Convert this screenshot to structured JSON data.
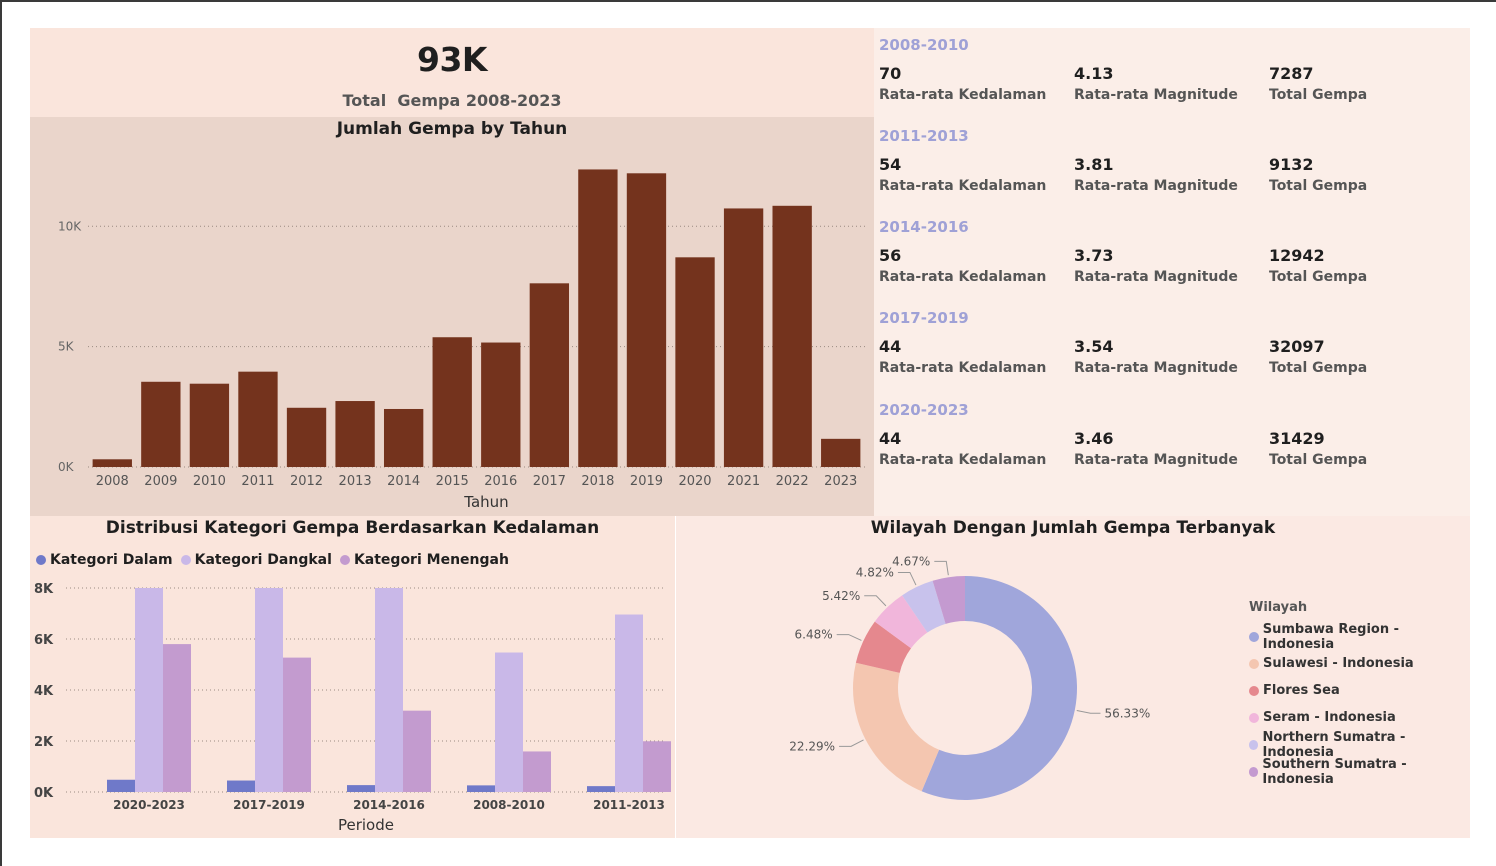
{
  "kpi": {
    "value": "93K",
    "label": "Total  Gempa 2008-2023"
  },
  "colors": {
    "bar_year": "#74331d",
    "dalam": "#6f79c9",
    "dangkal": "#c9b8e8",
    "menengah": "#c39bcf",
    "period_title": "#9fa1d6"
  },
  "periods": [
    {
      "title": "2008-2010",
      "depth": "70",
      "magnitude": "4.13",
      "total": "7287"
    },
    {
      "title": "2011-2013",
      "depth": "54",
      "magnitude": "3.81",
      "total": "9132"
    },
    {
      "title": "2014-2016",
      "depth": "56",
      "magnitude": "3.73",
      "total": "12942"
    },
    {
      "title": "2017-2019",
      "depth": "44",
      "magnitude": "3.54",
      "total": "32097"
    },
    {
      "title": "2020-2023",
      "depth": "44",
      "magnitude": "3.46",
      "total": "31429"
    }
  ],
  "stat_labels": {
    "depth": "Rata-rata Kedalaman",
    "magnitude": "Rata-rata Magnitude",
    "total": "Total Gempa"
  },
  "chart_data": [
    {
      "type": "bar",
      "title": "Jumlah Gempa by Tahun",
      "xlabel": "Tahun",
      "ylabel": "",
      "categories": [
        "2008",
        "2009",
        "2010",
        "2011",
        "2012",
        "2013",
        "2014",
        "2015",
        "2016",
        "2017",
        "2018",
        "2019",
        "2020",
        "2021",
        "2022",
        "2023"
      ],
      "values": [
        320,
        3540,
        3460,
        3960,
        2460,
        2740,
        2410,
        5390,
        5170,
        7630,
        12360,
        12200,
        8710,
        10740,
        10850,
        1170
      ],
      "ylim": [
        0,
        13500
      ],
      "yticks": [
        0,
        5000,
        10000
      ],
      "ytick_labels": [
        "0K",
        "5K",
        "10K"
      ],
      "grid": true
    },
    {
      "type": "bar",
      "title": "Distribusi Kategori Gempa Berdasarkan Kedalaman",
      "xlabel": "Periode",
      "ylabel": "",
      "categories": [
        "2020-2023",
        "2017-2019",
        "2014-2016",
        "2008-2010",
        "2011-2013"
      ],
      "series": [
        {
          "name": "Kategori Dalam",
          "values": [
            480,
            450,
            270,
            260,
            230
          ]
        },
        {
          "name": "Kategori Dangkal",
          "values": [
            8000,
            8000,
            8000,
            5470,
            6960
          ]
        },
        {
          "name": "Kategori Menengah",
          "values": [
            5800,
            5270,
            3190,
            1590,
            1990
          ]
        }
      ],
      "ylim": [
        0,
        8000
      ],
      "yticks": [
        0,
        2000,
        4000,
        6000,
        8000
      ],
      "ytick_labels": [
        "0K",
        "2K",
        "4K",
        "6K",
        "8K"
      ],
      "legend": "top-left",
      "grid": true
    },
    {
      "type": "pie",
      "title": "Wilayah Dengan Jumlah Gempa Terbanyak",
      "legend_title": "Wilayah",
      "legend": "right",
      "labels": [
        "Sumbawa Region - Indonesia",
        "Sulawesi - Indonesia",
        "Flores Sea",
        "Seram - Indonesia",
        "Northern Sumatra - Indonesia",
        "Southern Sumatra - Indonesia"
      ],
      "values": [
        56.33,
        22.29,
        6.48,
        5.42,
        4.82,
        4.67
      ],
      "value_labels": [
        "56.33%",
        "22.29%",
        "6.48%",
        "5.42%",
        "4.82%",
        "4.67%"
      ],
      "colors": [
        "#a0a6db",
        "#f4c6b0",
        "#e5888e",
        "#f1b6db",
        "#c8c2ec",
        "#c49ad0"
      ]
    }
  ]
}
